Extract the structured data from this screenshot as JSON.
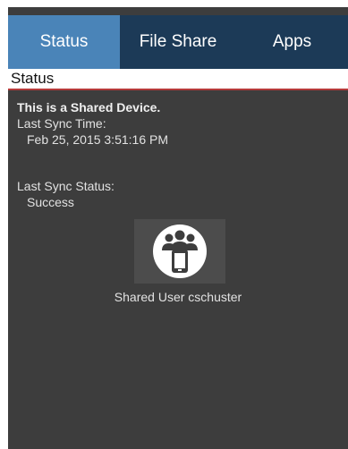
{
  "tabs": [
    {
      "label": "Status",
      "active": true
    },
    {
      "label": "File Share",
      "active": false
    },
    {
      "label": "Apps",
      "active": false
    }
  ],
  "section_title": "Status",
  "status": {
    "shared_device_notice": "This is a Shared Device.",
    "last_sync_time_label": "Last Sync Time:",
    "last_sync_time_value": "Feb 25, 2015 3:51:16 PM",
    "last_sync_status_label": "Last Sync Status:",
    "last_sync_status_value": "Success"
  },
  "shared_user": {
    "icon": "shared-user-device-icon",
    "label": "Shared User cschuster"
  },
  "colors": {
    "tab_bar": "#1c3a57",
    "tab_active": "#4a84b8",
    "background": "#3d3d3d",
    "header_divider": "#b53a3a"
  }
}
